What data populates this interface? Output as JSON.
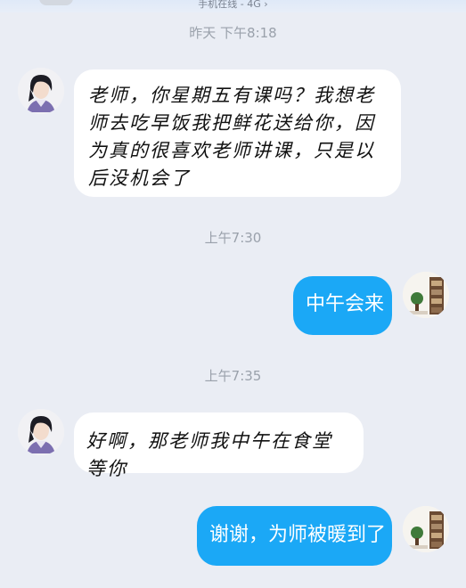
{
  "status": {
    "online_text": "手机在线 - 4G ›"
  },
  "messages": [
    {
      "time": "昨天 下午8:18",
      "side": "in",
      "text": "老师，你星期五有课吗？我想老师去吃早饭我把鲜花送给你，因为真的很喜欢老师讲课，只是以后没机会了"
    },
    {
      "time": "上午7:30",
      "side": "out",
      "text": "中午会来"
    },
    {
      "time": "上午7:35",
      "side": "in",
      "text": "好啊，那老师我中午在食堂等你"
    },
    {
      "side": "out",
      "text": "谢谢，为师被暖到了"
    }
  ],
  "colors": {
    "background": "#eaedf4",
    "outgoing_bubble": "#1ba8f6",
    "incoming_bubble": "#ffffff"
  }
}
